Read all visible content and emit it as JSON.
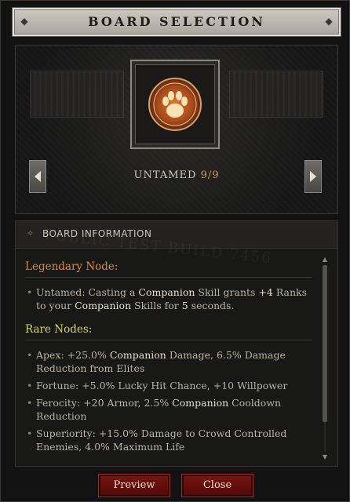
{
  "window": {
    "title": "BOARD SELECTION"
  },
  "board": {
    "name": "UNTAMED",
    "count": "9/9",
    "glyph_icon": "paw-print-icon",
    "prev_icon": "arrow-left-icon",
    "next_icon": "arrow-right-icon"
  },
  "info": {
    "header": "BOARD INFORMATION",
    "watermark": "PUBLIC TEST BUILD 7456",
    "legendary_title": "Legendary Node:",
    "legendary": {
      "pre": "Untamed: Casting a ",
      "hl1": "Companion",
      "mid1": " Skill grants ",
      "num1": "+4",
      "mid2": " Ranks to your ",
      "hl2": "Companion",
      "mid3": " Skills for ",
      "num2": "5",
      "post": " seconds."
    },
    "rare_title": "Rare Nodes:",
    "rare": [
      {
        "a": "Apex: +25.0% ",
        "hl": "Companion",
        "b": " Damage, 6.5% Damage Reduction from Elites"
      },
      {
        "a": "Fortune: +5.0% Lucky Hit Chance, +10 Willpower",
        "hl": "",
        "b": ""
      },
      {
        "a": "Ferocity: +20 Armor, 2.5% ",
        "hl": "Companion",
        "b": " Cooldown Reduction"
      },
      {
        "a": "Superiority: +15.0% Damage to Crowd Controlled Enemies, 4.0% Maximum Life",
        "hl": "",
        "b": ""
      }
    ]
  },
  "buttons": {
    "preview": "Preview",
    "close": "Close"
  },
  "colors": {
    "legendary": "#e0863a",
    "rare": "#d8d35c",
    "button": "#7a1410",
    "count": "#d69a5a"
  }
}
